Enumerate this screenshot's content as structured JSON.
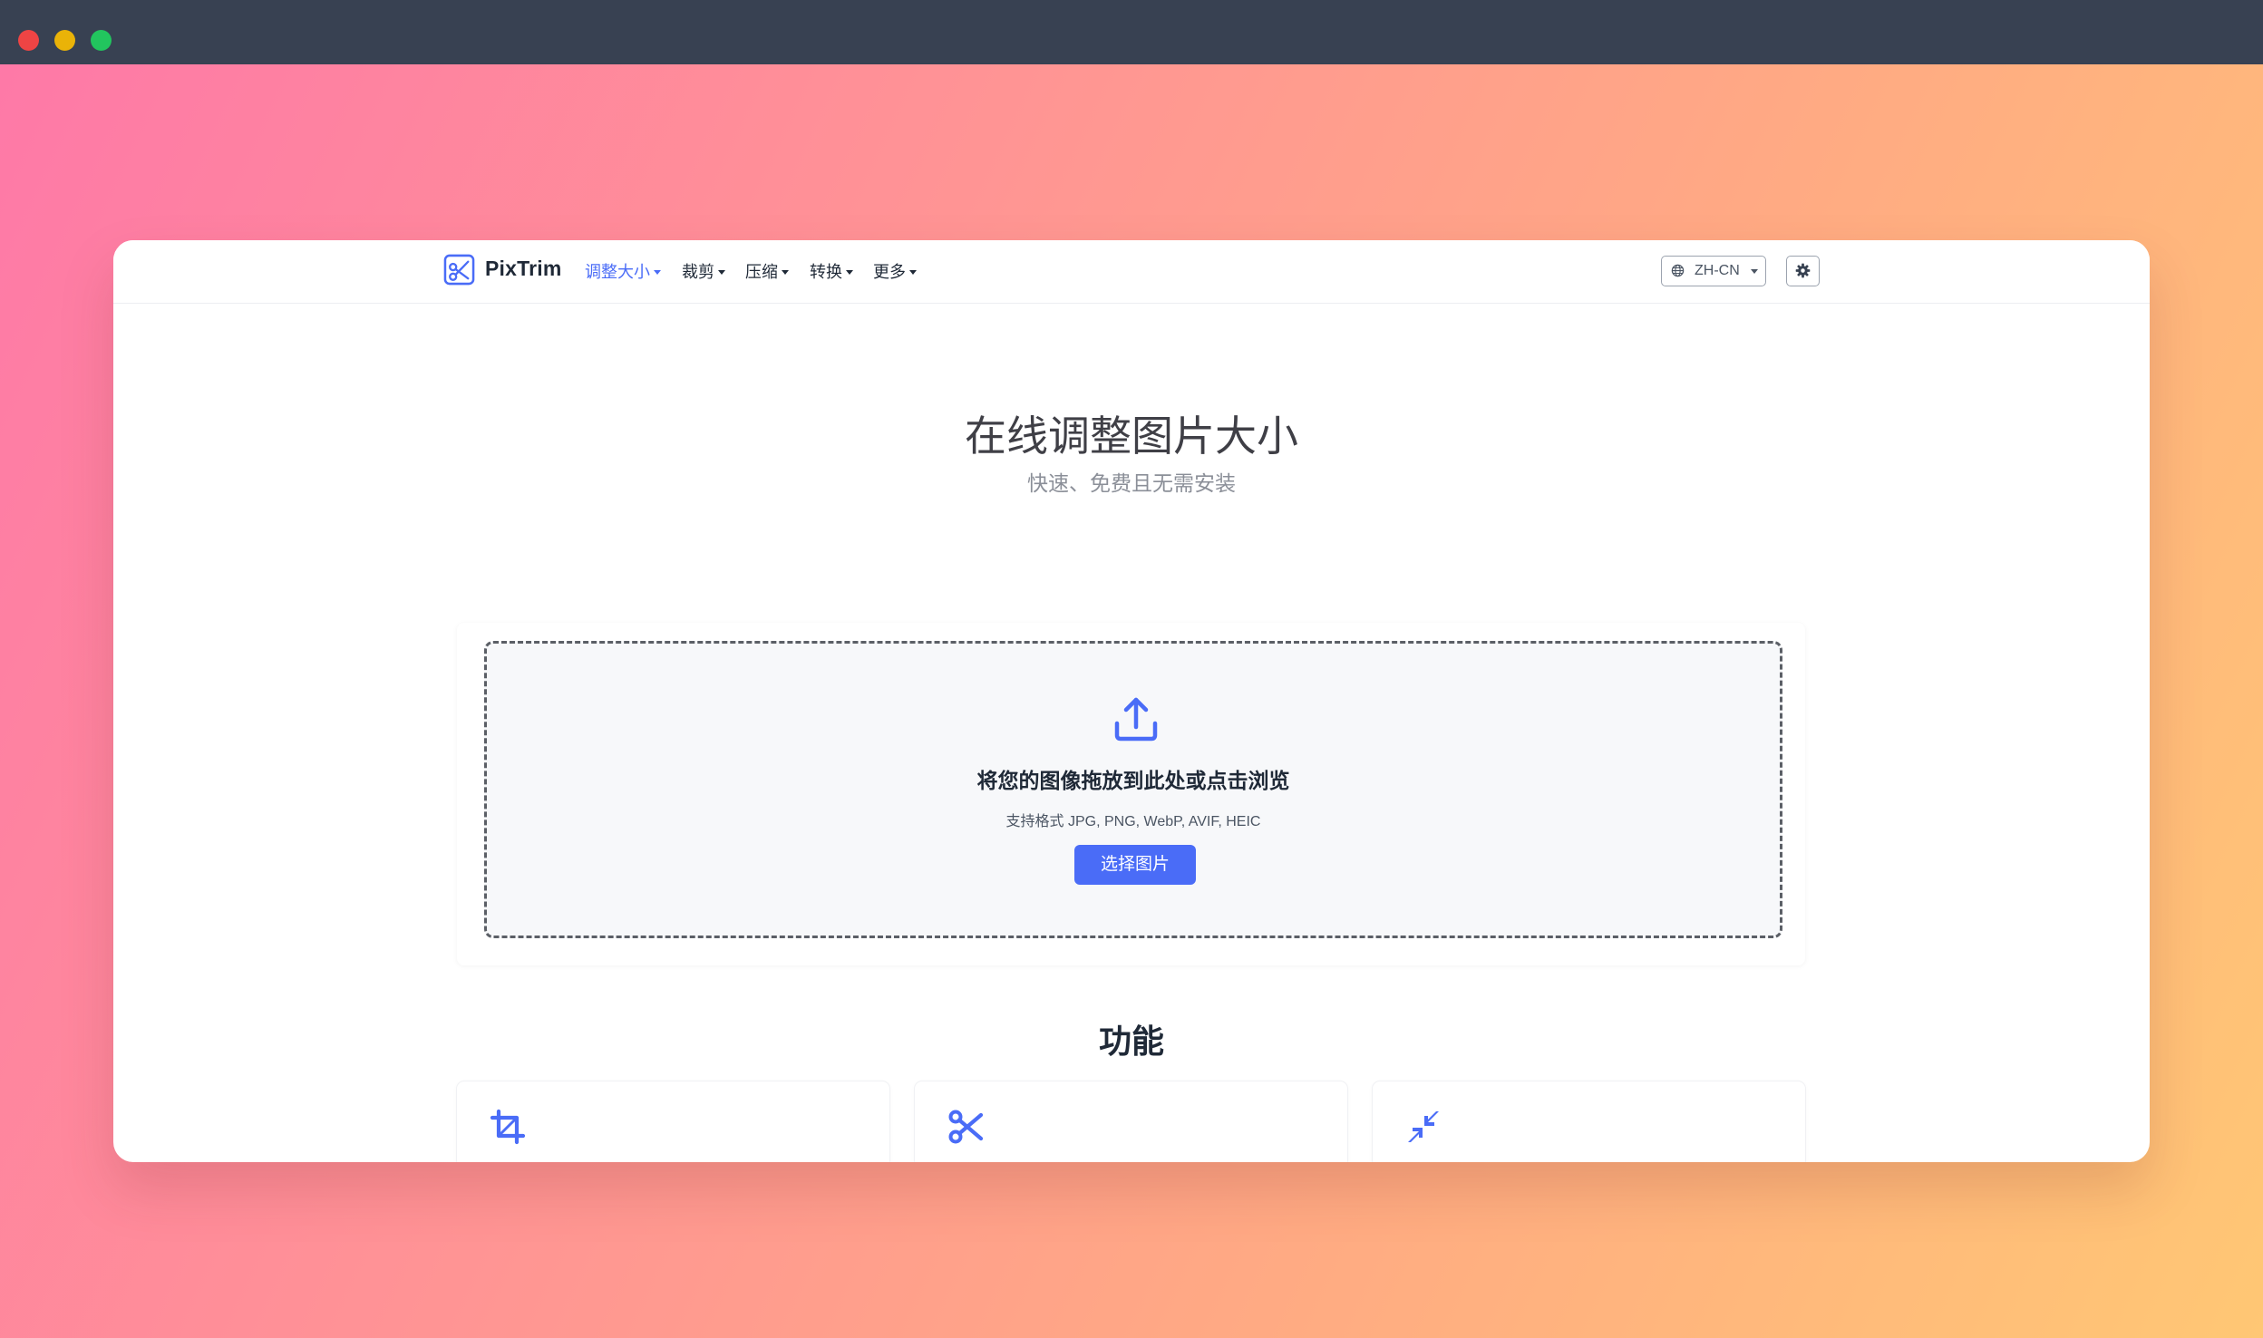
{
  "window_controls": [
    "close",
    "minimize",
    "maximize"
  ],
  "colors": {
    "accent": "#4a6cf7",
    "titlebar": "#384152"
  },
  "navbar": {
    "brand": "PixTrim",
    "logo_icon": "scissors-logo-icon",
    "items": [
      {
        "label": "调整大小",
        "active": true
      },
      {
        "label": "裁剪",
        "active": false
      },
      {
        "label": "压缩",
        "active": false
      },
      {
        "label": "转换",
        "active": false
      },
      {
        "label": "更多",
        "active": false
      }
    ],
    "language": {
      "icon": "globe-icon",
      "value": "ZH-CN"
    },
    "settings_icon": "gear-icon"
  },
  "hero": {
    "title": "在线调整图片大小",
    "subtitle": "快速、免费且无需安装"
  },
  "upload": {
    "icon": "upload-icon",
    "title": "将您的图像拖放到此处或点击浏览",
    "formats": "支持格式 JPG, PNG, WebP, AVIF, HEIC",
    "button_label": "选择图片"
  },
  "features": {
    "title": "功能",
    "cards": [
      {
        "icon": "crop-icon"
      },
      {
        "icon": "scissors-icon"
      },
      {
        "icon": "compress-icon"
      }
    ]
  }
}
